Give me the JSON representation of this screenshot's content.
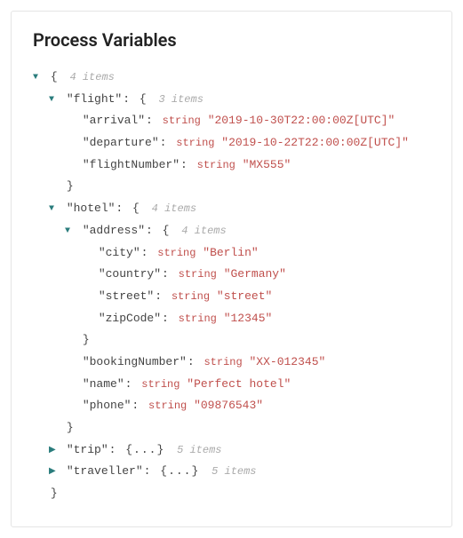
{
  "title": "Process Variables",
  "labels": {
    "string": "string",
    "items": "items"
  },
  "root": {
    "count": "4 items"
  },
  "flight": {
    "key": "\"flight\"",
    "count": "3 items",
    "arrival": {
      "key": "\"arrival\"",
      "value": "\"2019-10-30T22:00:00Z[UTC]\""
    },
    "departure": {
      "key": "\"departure\"",
      "value": "\"2019-10-22T22:00:00Z[UTC]\""
    },
    "flightNumber": {
      "key": "\"flightNumber\"",
      "value": "\"MX555\""
    }
  },
  "hotel": {
    "key": "\"hotel\"",
    "count": "4 items",
    "address": {
      "key": "\"address\"",
      "count": "4 items",
      "city": {
        "key": "\"city\"",
        "value": "\"Berlin\""
      },
      "country": {
        "key": "\"country\"",
        "value": "\"Germany\""
      },
      "street": {
        "key": "\"street\"",
        "value": "\"street\""
      },
      "zipCode": {
        "key": "\"zipCode\"",
        "value": "\"12345\""
      }
    },
    "bookingNumber": {
      "key": "\"bookingNumber\"",
      "value": "\"XX-012345\""
    },
    "name": {
      "key": "\"name\"",
      "value": "\"Perfect hotel\""
    },
    "phone": {
      "key": "\"phone\"",
      "value": "\"09876543\""
    }
  },
  "trip": {
    "key": "\"trip\"",
    "collapsed": "{...}",
    "count": "5 items"
  },
  "traveller": {
    "key": "\"traveller\"",
    "collapsed": "{...}",
    "count": "5 items"
  }
}
